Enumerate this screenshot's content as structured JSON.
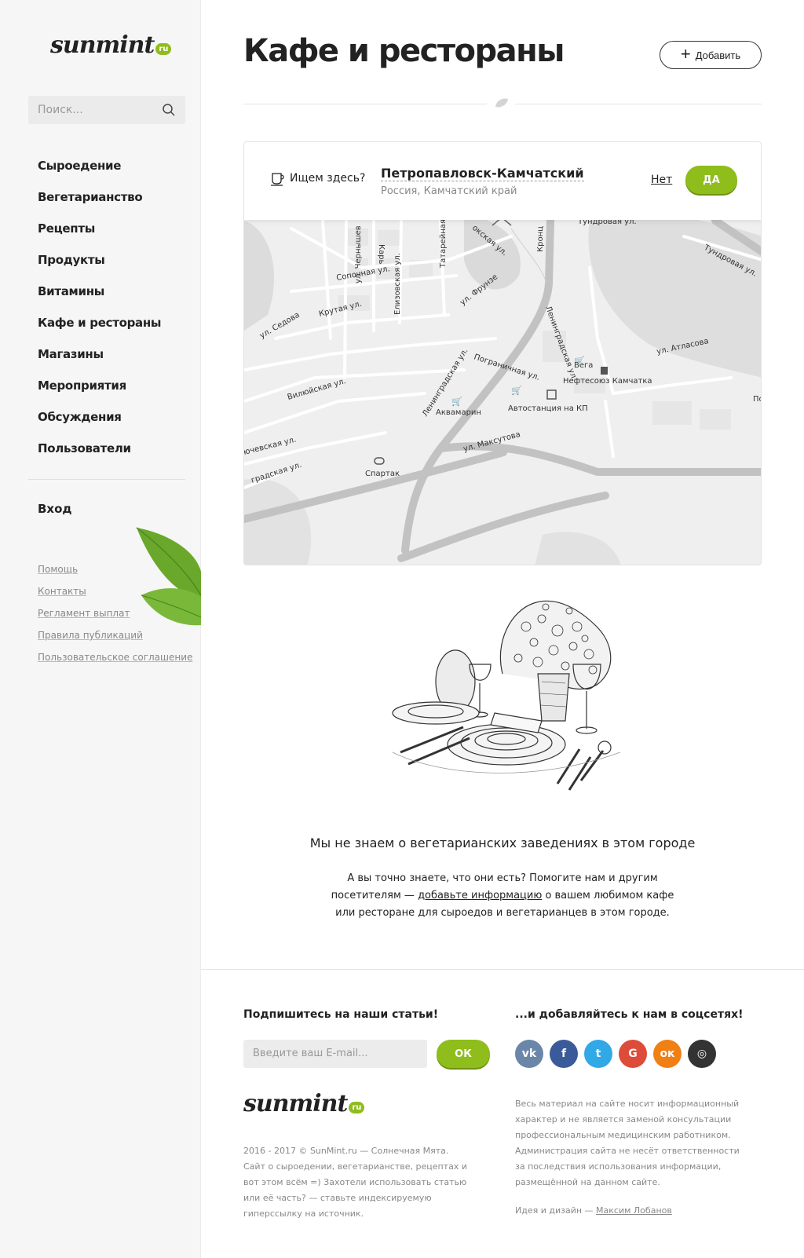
{
  "sidebar": {
    "logo_text": "sunmint",
    "logo_badge": "ru",
    "search_placeholder": "Поиск...",
    "nav": [
      "Сыроедение",
      "Вегетарианство",
      "Рецепты",
      "Продукты",
      "Витамины",
      "Кафе и рестораны",
      "Магазины",
      "Мероприятия",
      "Обсуждения",
      "Пользователи"
    ],
    "login": "Вход",
    "footer_links": [
      "Помощь",
      "Контакты",
      "Регламент выплат",
      "Правила публикаций",
      "Пользовательское соглашение"
    ]
  },
  "main": {
    "title": "Кафе и рестораны",
    "add_label": "Добавить",
    "geo": {
      "ask": "Ищем здесь?",
      "city": "Петропавловск-Камчатский",
      "region": "Россия, Камчатский край",
      "no": "Нет",
      "yes": "ДА"
    },
    "map_labels": [
      "окская ул.",
      "Кронц",
      "Тундровая ул.",
      "Тундровая ул.",
      "ул. Чернышев",
      "Карь",
      "Елизовская ул.",
      "Татарейная ул.",
      "Ленинградская ул.",
      "Сопочная ул.",
      "ул. Фрунзе",
      "Крутая ул.",
      "ул. Седова",
      "ул. Атласова",
      "Вега",
      "Нефтесоюз Камчатка",
      "Пограничная ул.",
      "Ленинградская ул.",
      "Вилюйская ул.",
      "Автостанция на КП",
      "Аквамарин",
      "ул. Максутова",
      "ючевская ул.",
      "градская ул.",
      "Спартак",
      "По"
    ],
    "empty_title": "Мы не знаем о вегетарианских заведениях в этом городе",
    "empty_desc_1": "А вы точно знаете, что они есть? Помогите нам и другим посетителям —",
    "empty_desc_link": "добавьте информацию",
    "empty_desc_2": "о вашем любимом кафе или ресторане для сыроедов и вегетарианцев в этом городе."
  },
  "footer": {
    "subscribe_title": "Подпишитесь на наши статьи!",
    "email_placeholder": "Введите ваш E-mail...",
    "ok": "ОК",
    "social_title": "...и добавляйтесь к нам в соцсетях!",
    "socials": [
      {
        "name": "vk",
        "glyph": "vk",
        "color": "#6a86a8"
      },
      {
        "name": "facebook",
        "glyph": "f",
        "color": "#3b5a9a"
      },
      {
        "name": "twitter",
        "glyph": "t",
        "color": "#30a9e6"
      },
      {
        "name": "google",
        "glyph": "G",
        "color": "#dd4b39"
      },
      {
        "name": "odnoklassniki",
        "glyph": "ок",
        "color": "#f07f14"
      },
      {
        "name": "instagram",
        "glyph": "◎",
        "color": "#333333"
      }
    ],
    "copyright_1": "2016 - 2017 © SunMint.ru — Солнечная Мята.",
    "copyright_2": "Сайт о сыроедении, вегетарианстве, рецептах и вот этом всём =) Захотели использовать статью или её часть? — ставьте индексируемую гиперссылку на источник.",
    "disclaimer": "Весь материал на сайте носит информационный характер и не является заменой консультации профессиональным медицинским работником. Администрация сайта не несёт ответственности за последствия использования информации, размещённой на данном сайте.",
    "credits_prefix": "Идея и дизайн —",
    "credits_author": "Максим Лобанов"
  },
  "colors": {
    "accent": "#8fbd1b",
    "text": "#222222",
    "muted": "#888888"
  }
}
